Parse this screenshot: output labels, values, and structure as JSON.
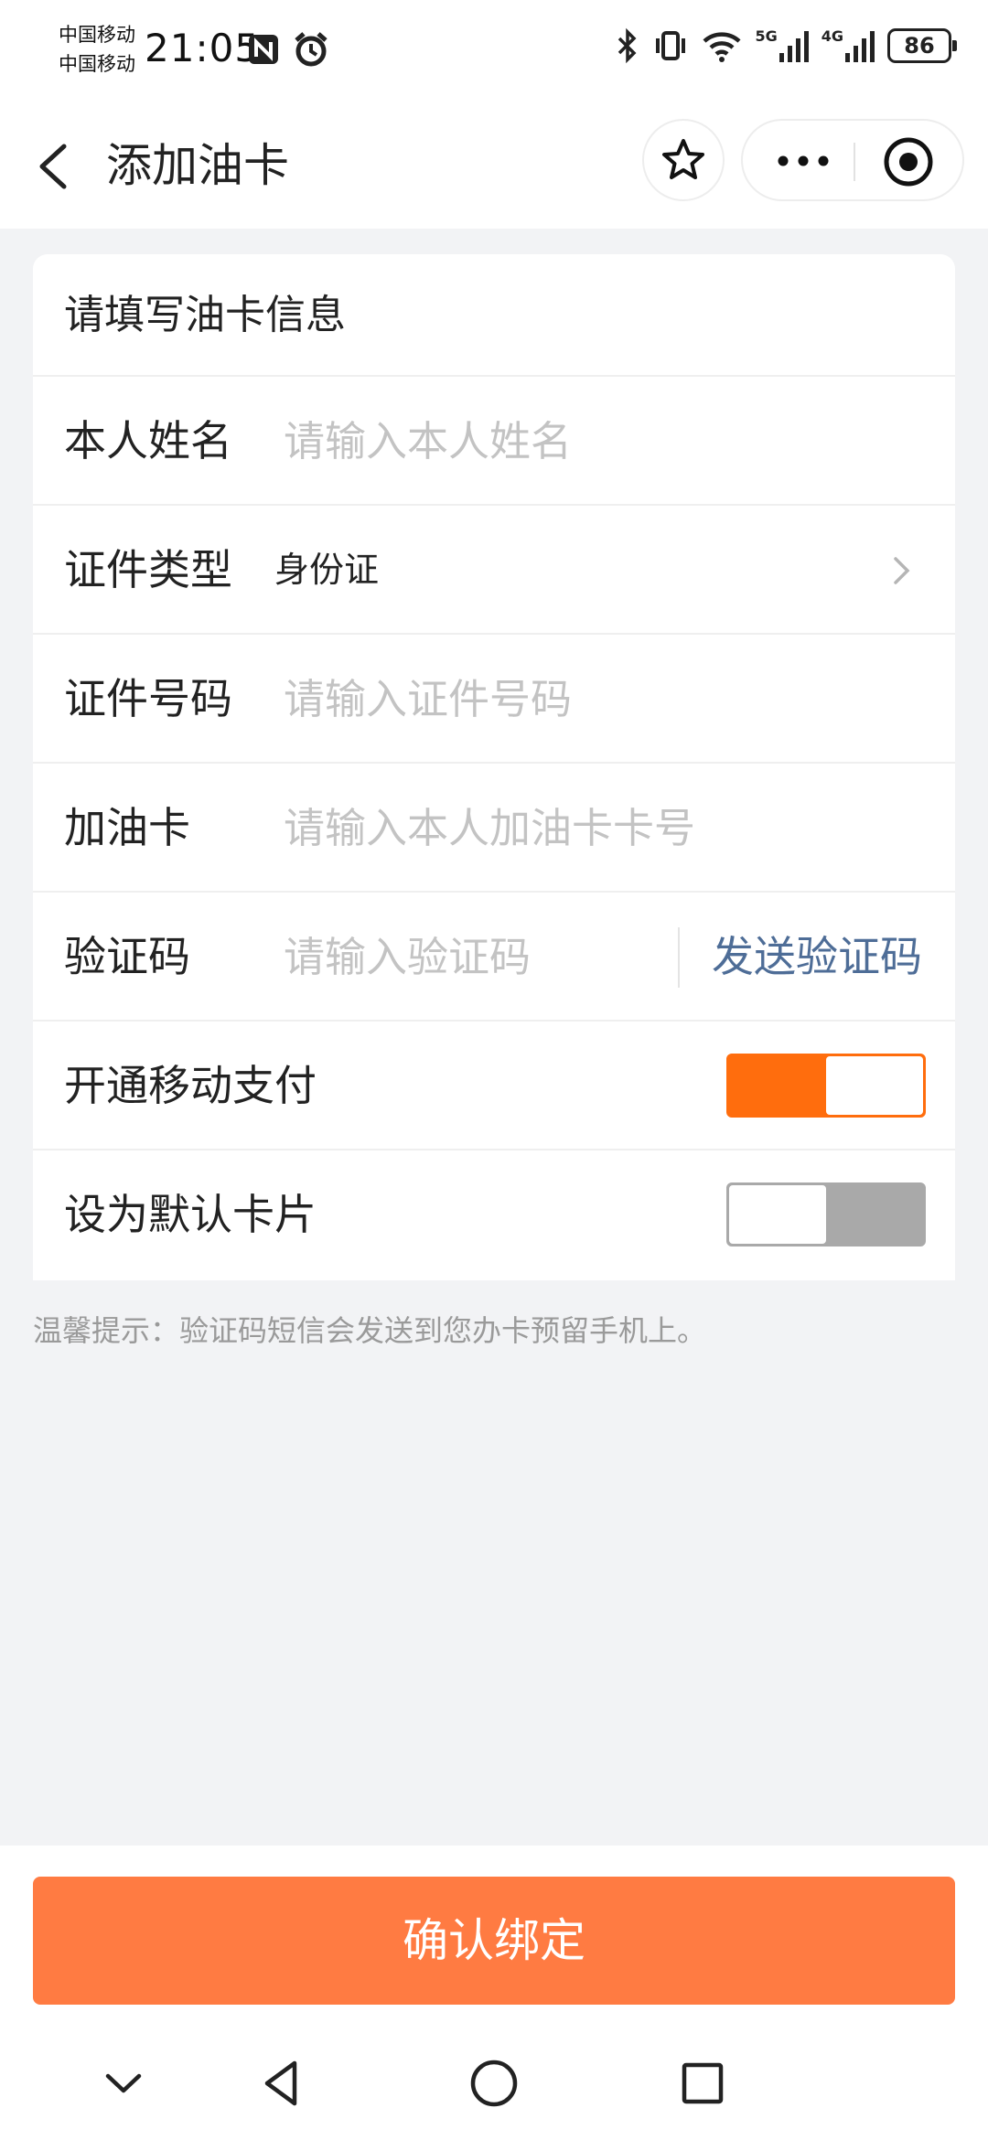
{
  "status_bar": {
    "carrier_1": "中国移动",
    "carrier_2": "中国移动",
    "time": "21:05",
    "battery": "86",
    "network_1": "5G",
    "network_2": "4G"
  },
  "nav": {
    "title": "添加油卡"
  },
  "form": {
    "header": "请填写油卡信息",
    "rows": [
      {
        "label": "本人姓名",
        "placeholder": "请输入本人姓名"
      },
      {
        "label": "证件类型",
        "value": "身份证"
      },
      {
        "label": "证件号码",
        "placeholder": "请输入证件号码"
      },
      {
        "label": "加油卡",
        "placeholder": "请输入本人加油卡卡号"
      },
      {
        "label": "验证码",
        "placeholder": "请输入验证码",
        "action": "发送验证码"
      },
      {
        "label": "开通移动支付",
        "toggle_on": true
      },
      {
        "label": "设为默认卡片",
        "toggle_on": false
      }
    ]
  },
  "tip": "温馨提示：验证码短信会发送到您办卡预留手机上。",
  "confirm_button": "确认绑定",
  "colors": {
    "accent": "#ff6d0d",
    "confirm": "#ff7b42",
    "link": "#4e6d97"
  },
  "icons": [
    "back-icon",
    "star-icon",
    "more-icon",
    "close-target-icon",
    "chevron-right-icon",
    "chevron-down-icon",
    "back-triangle-icon",
    "home-circle-icon",
    "recents-square-icon"
  ]
}
